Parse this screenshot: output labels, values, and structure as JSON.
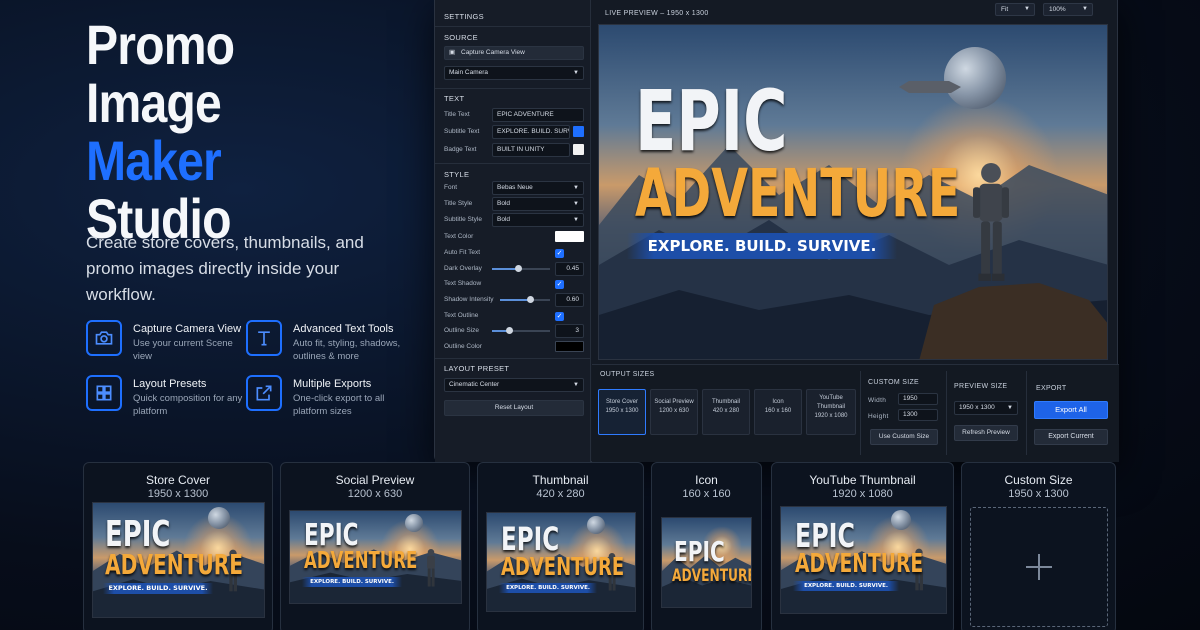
{
  "hero": {
    "title_line1": "Promo Image",
    "title_line2": "Maker",
    "title_line3": "Studio",
    "description": "Create store covers, thumbnails, and promo images directly inside your workflow."
  },
  "features": [
    {
      "icon": "camera-icon",
      "title": "Capture Camera View",
      "desc": "Use your current Scene view"
    },
    {
      "icon": "text-icon",
      "title": "Advanced Text Tools",
      "desc": "Auto fit, styling, shadows, outlines & more"
    },
    {
      "icon": "layout-icon",
      "title": "Layout Presets",
      "desc": "Quick composition for any platform"
    },
    {
      "icon": "export-icon",
      "title": "Multiple Exports",
      "desc": "One-click export to all platform sizes"
    }
  ],
  "settings": {
    "header": "SETTINGS",
    "source": {
      "header": "SOURCE",
      "capture_button": "Capture Camera View",
      "camera_select": "Main Camera"
    },
    "text": {
      "header": "TEXT",
      "title_label": "Title Text",
      "title_value": "EPIC ADVENTURE",
      "subtitle_label": "Subtitle Text",
      "subtitle_value": "EXPLORE. BUILD. SURVIVE.",
      "badge_label": "Badge Text",
      "badge_value": "BUILT IN UNITY"
    },
    "style": {
      "header": "STYLE",
      "font_label": "Font",
      "font_value": "Bebas Neue",
      "title_style_label": "Title Style",
      "title_style_value": "Bold",
      "subtitle_style_label": "Subtitle Style",
      "subtitle_style_value": "Bold",
      "text_color_label": "Text Color",
      "auto_fit_label": "Auto Fit Text",
      "dark_overlay_label": "Dark Overlay",
      "dark_overlay_value": "0.45",
      "text_shadow_label": "Text Shadow",
      "shadow_intensity_label": "Shadow Intensity",
      "shadow_intensity_value": "0.60",
      "text_outline_label": "Text Outline",
      "outline_size_label": "Outline Size",
      "outline_size_value": "3",
      "outline_color_label": "Outline Color"
    },
    "layout": {
      "header": "LAYOUT PRESET",
      "preset_value": "Cinematic Center",
      "reset_button": "Reset Layout"
    }
  },
  "preview": {
    "header": "LIVE PREVIEW – 1950 x 1300",
    "fit_select": "Fit",
    "zoom_select": "100%"
  },
  "art": {
    "title1": "EPIC",
    "title2": "ADVENTURE",
    "subtitle": "EXPLORE. BUILD. SURVIVE."
  },
  "output_sizes": {
    "header": "OUTPUT SIZES",
    "items": [
      {
        "name": "Store Cover",
        "size": "1950 x 1300"
      },
      {
        "name": "Social Preview",
        "size": "1200 x 630"
      },
      {
        "name": "Thumbnail",
        "size": "420 x 280"
      },
      {
        "name": "Icon",
        "size": "160 x 160"
      },
      {
        "name": "YouTube Thumbnail",
        "size": "1920 x 1080"
      }
    ]
  },
  "custom_size": {
    "header": "CUSTOM SIZE",
    "width_label": "Width",
    "width_value": "1950",
    "height_label": "Height",
    "height_value": "1300",
    "button": "Use Custom Size"
  },
  "preview_size": {
    "header": "PREVIEW SIZE",
    "select": "1950 x 1300",
    "refresh_button": "Refresh Preview"
  },
  "export": {
    "header": "EXPORT",
    "export_all": "Export All",
    "export_current": "Export Current"
  },
  "thumbnails": [
    {
      "name": "Store Cover",
      "size": "1950 x 1300"
    },
    {
      "name": "Social Preview",
      "size": "1200 x 630"
    },
    {
      "name": "Thumbnail",
      "size": "420 x 280"
    },
    {
      "name": "Icon",
      "size": "160 x 160"
    },
    {
      "name": "YouTube Thumbnail",
      "size": "1920 x 1080"
    },
    {
      "name": "Custom Size",
      "size": "1950 x 1300"
    }
  ],
  "colors": {
    "accent": "#1e6fff",
    "title_orange": "#f4a93a",
    "banner_blue": "#1d4ea8"
  }
}
